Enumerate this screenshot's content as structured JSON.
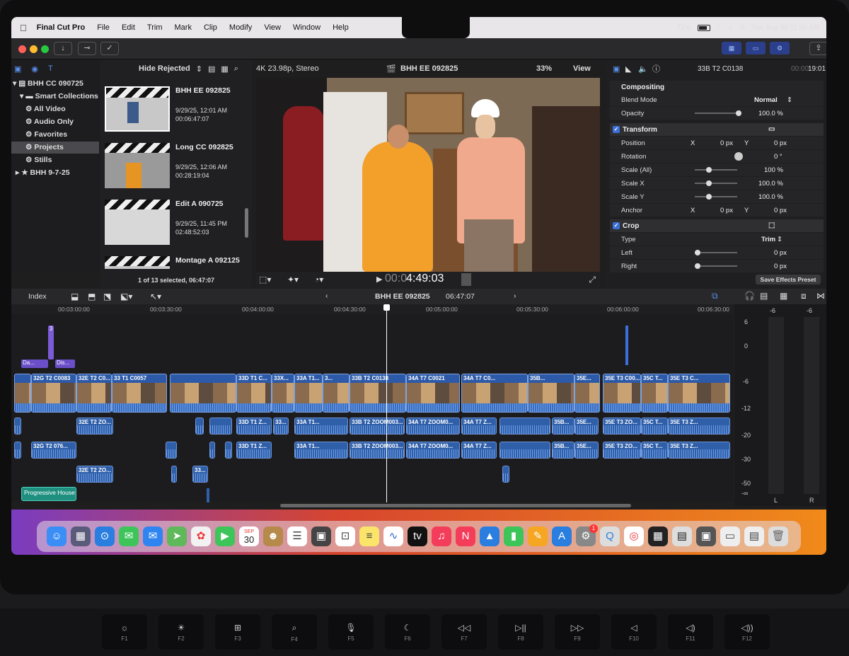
{
  "menubar": {
    "app": "Final Cut Pro",
    "items": [
      "File",
      "Edit",
      "Trim",
      "Mark",
      "Clip",
      "Modify",
      "View",
      "Window",
      "Help"
    ],
    "battery": "71%",
    "datetime": "Tue Sep 30  11:50 AM"
  },
  "library": {
    "root": "BHH CC 090725",
    "smart": "Smart Collections",
    "items": [
      "All Video",
      "Audio Only",
      "Favorites",
      "Projects",
      "Stills"
    ],
    "other": "BHH 9-7-25"
  },
  "browser": {
    "filter": "Hide Rejected",
    "clips": [
      {
        "name": "BHH EE 092825",
        "date": "9/29/25, 12:01 AM",
        "dur": "00:06:47:07"
      },
      {
        "name": "Long CC 092825",
        "date": "9/29/25, 12:06 AM",
        "dur": "00:28:19:04"
      },
      {
        "name": "Edit A 090725",
        "date": "9/29/25, 11:45 PM",
        "dur": "02:48:52:03"
      },
      {
        "name": "Montage A 092125",
        "date": "",
        "dur": ""
      }
    ],
    "status": "1 of 13 selected, 06:47:07"
  },
  "viewer": {
    "format": "4K 23.98p, Stereo",
    "title": "BHH EE 092825",
    "zoom": "33%",
    "view": "View",
    "timecode": "00:04:49:03",
    "tc_prefix": "00:0",
    "tc_main": "4:49:03"
  },
  "inspector": {
    "clip": "33B T2 C0138",
    "duration": "19:01",
    "dur_dim": "00:00:",
    "compositing": "Compositing",
    "blend_label": "Blend Mode",
    "blend_val": "Normal",
    "opacity_label": "Opacity",
    "opacity_val": "100.0 %",
    "transform": "Transform",
    "position": "Position",
    "pos_x": "0 px",
    "pos_y": "0 px",
    "rotation": "Rotation",
    "rot_val": "0 °",
    "scale_all": "Scale (All)",
    "scale_all_val": "100 %",
    "scale_x": "Scale X",
    "scale_x_val": "100.0 %",
    "scale_y": "Scale Y",
    "scale_y_val": "100.0 %",
    "anchor": "Anchor",
    "anc_x": "0 px",
    "anc_y": "0 px",
    "crop": "Crop",
    "type": "Type",
    "type_val": "Trim",
    "left": "Left",
    "left_val": "0 px",
    "right": "Right",
    "right_val": "0 px",
    "save_preset": "Save Effects Preset",
    "x": "X",
    "y": "Y"
  },
  "timeline": {
    "index": "Index",
    "project": "BHH EE 092825",
    "duration": "06:47:07",
    "ruler": [
      "00:03:00:00",
      "00:03:30:00",
      "00:04:00:00",
      "00:04:30:00",
      "00:05:00:00",
      "00:05:30:00",
      "00:06:00:00",
      "00:06:30:00"
    ],
    "video_clips": [
      "32G T2 C0083",
      "32E T2 C0...",
      "33 T1 C0057",
      "33D T1 C...",
      "33X...",
      "33A T1...",
      "3...",
      "33B T2 C0138",
      "34A T7 C0021",
      "34A T7 C0...",
      "35B...",
      "35E...",
      "35E T3 C00...",
      "35C T...",
      "35E T3 C..."
    ],
    "audio1": [
      "32E T2 ZO...",
      "33D T1 Z...",
      "33...",
      "33A T1...",
      "33B T2 ZOOM003...",
      "34A T7 ZOOM0...",
      "34A T7 Z...",
      "35B...",
      "35E...",
      "35E T3 ZO...",
      "35C T...",
      "35E T3 Z..."
    ],
    "audio2": [
      "32G T2 076...",
      "33D T1 Z...",
      "33A T1...",
      "33B T2 ZOOM003...",
      "34A T7 ZOOM0...",
      "34A T7 Z...",
      "35B...",
      "35E...",
      "35E T3 ZO...",
      "35C T...",
      "35E T3 Z..."
    ],
    "audio3": [
      "32E T2 ZO...",
      "33..."
    ],
    "music": "Progressive House",
    "titles": [
      "Da...",
      "Dis..."
    ],
    "connected": "3"
  },
  "meters": {
    "scale": [
      "6",
      "0",
      "-6",
      "-12",
      "-20",
      "-30",
      "-50",
      "-∞"
    ],
    "top": [
      "-6",
      "-6"
    ],
    "L": "L",
    "R": "R"
  },
  "dock": {
    "calendar_month": "SEP",
    "calendar_day": "30",
    "badge": "1"
  },
  "keys": [
    {
      "icon": "☼",
      "fn": "F1"
    },
    {
      "icon": "☀",
      "fn": "F2"
    },
    {
      "icon": "⊞",
      "fn": "F3"
    },
    {
      "icon": "⌕",
      "fn": "F4"
    },
    {
      "icon": "🎙",
      "fn": "F5"
    },
    {
      "icon": "☾",
      "fn": "F6"
    },
    {
      "icon": "◁◁",
      "fn": "F7"
    },
    {
      "icon": "▷||",
      "fn": "F8"
    },
    {
      "icon": "▷▷",
      "fn": "F9"
    },
    {
      "icon": "◁",
      "fn": "F10"
    },
    {
      "icon": "◁)",
      "fn": "F11"
    },
    {
      "icon": "◁))",
      "fn": "F12"
    }
  ]
}
